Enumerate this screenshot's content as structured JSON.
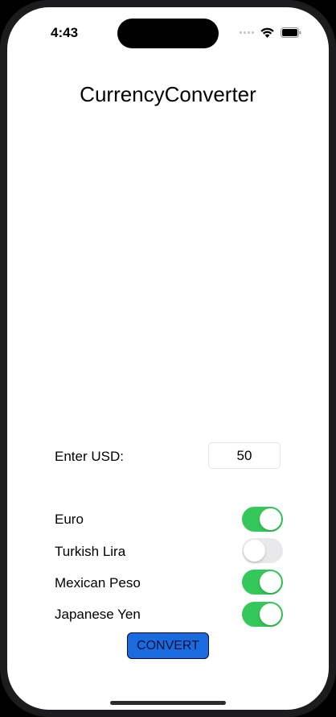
{
  "status_bar": {
    "time": "4:43"
  },
  "app": {
    "title": "CurrencyConverter"
  },
  "usd": {
    "label": "Enter USD:",
    "value": "50"
  },
  "currencies": [
    {
      "label": "Euro",
      "enabled": true
    },
    {
      "label": "Turkish Lira",
      "enabled": false
    },
    {
      "label": "Mexican Peso",
      "enabled": true
    },
    {
      "label": "Japanese Yen",
      "enabled": true
    }
  ],
  "convert_button": {
    "label": "CONVERT"
  },
  "colors": {
    "toggle_on": "#34c759",
    "toggle_off": "#e9e9eb",
    "button": "#1a6be0"
  }
}
